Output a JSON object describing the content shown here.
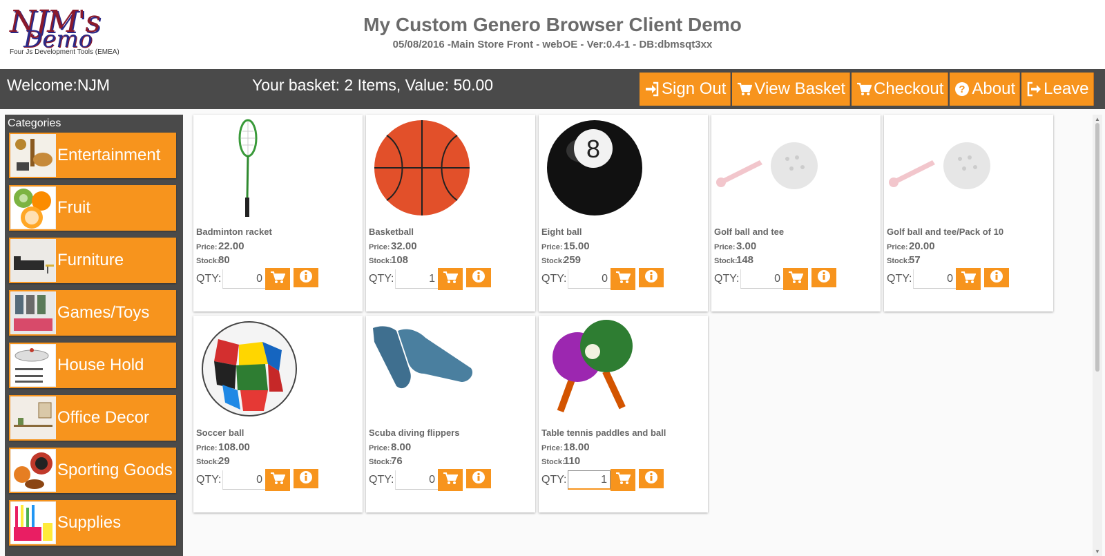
{
  "header": {
    "logo_main": "NJM's",
    "logo_sub": "Demo",
    "logo_tagline": "Four Js Development Tools (EMEA)",
    "title": "My Custom Genero Browser Client Demo",
    "subtitle": "05/08/2016 -Main Store Front - webOE - Ver:0.4-1 - DB:dbmsqt3xx"
  },
  "topbar": {
    "welcome": "Welcome:NJM",
    "basket": "Your basket: 2 Items, Value: 50.00",
    "buttons": [
      {
        "label": "Sign Out",
        "icon": "sign-in-icon"
      },
      {
        "label": "View Basket",
        "icon": "cart-icon"
      },
      {
        "label": "Checkout",
        "icon": "cart-icon"
      },
      {
        "label": "About",
        "icon": "question-circle-icon"
      },
      {
        "label": "Leave",
        "icon": "sign-out-icon"
      }
    ]
  },
  "sidebar": {
    "title": "Categories",
    "items": [
      {
        "label": "Entertainment"
      },
      {
        "label": "Fruit"
      },
      {
        "label": "Furniture"
      },
      {
        "label": "Games/Toys"
      },
      {
        "label": "House Hold"
      },
      {
        "label": "Office Decor"
      },
      {
        "label": "Sporting Goods"
      },
      {
        "label": "Supplies"
      }
    ]
  },
  "products": {
    "price_label": "Price:",
    "stock_label": "Stock:",
    "qty_label": "QTY:",
    "items": [
      {
        "name": "Badminton racket",
        "price": "22.00",
        "stock": "80",
        "qty": "0"
      },
      {
        "name": "Basketball",
        "price": "32.00",
        "stock": "108",
        "qty": "1"
      },
      {
        "name": "Eight ball",
        "price": "15.00",
        "stock": "259",
        "qty": "0"
      },
      {
        "name": "Golf ball and tee",
        "price": "3.00",
        "stock": "148",
        "qty": "0"
      },
      {
        "name": "Golf ball and tee/Pack of 10",
        "price": "20.00",
        "stock": "57",
        "qty": "0"
      },
      {
        "name": "Soccer ball",
        "price": "108.00",
        "stock": "29",
        "qty": "0"
      },
      {
        "name": "Scuba diving flippers",
        "price": "8.00",
        "stock": "76",
        "qty": "0"
      },
      {
        "name": "Table tennis paddles and ball",
        "price": "18.00",
        "stock": "110",
        "qty": "1"
      }
    ]
  },
  "colors": {
    "accent": "#f7941d",
    "bar": "#4a4a4a",
    "title_text": "#6b6b6b"
  }
}
